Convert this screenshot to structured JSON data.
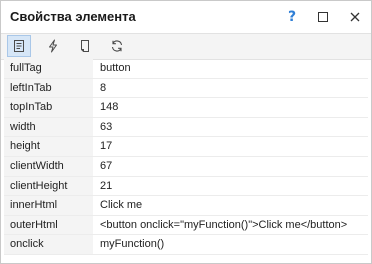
{
  "window": {
    "title": "Свойства элемента",
    "help_label": "?"
  },
  "toolbar": {
    "tools": [
      {
        "icon": "properties-icon",
        "active": true
      },
      {
        "icon": "events-lightning-icon",
        "active": false
      },
      {
        "icon": "page-icon",
        "active": false
      },
      {
        "icon": "refresh-icon",
        "active": false
      }
    ]
  },
  "properties": [
    {
      "key": "fullTag",
      "value": "button"
    },
    {
      "key": "leftInTab",
      "value": "8"
    },
    {
      "key": "topInTab",
      "value": "148"
    },
    {
      "key": "width",
      "value": "63"
    },
    {
      "key": "height",
      "value": "17"
    },
    {
      "key": "clientWidth",
      "value": "67"
    },
    {
      "key": "clientHeight",
      "value": "21"
    },
    {
      "key": "innerHtml",
      "value": "Click me"
    },
    {
      "key": "outerHtml",
      "value": "<button onclick=\"myFunction()\">Click me</button>"
    },
    {
      "key": "onclick",
      "value": "myFunction()"
    }
  ],
  "colors": {
    "accent": "#2f7fd6",
    "key_column_bg": "#f4f4f4",
    "active_tool_bg": "#d6e6f7"
  }
}
